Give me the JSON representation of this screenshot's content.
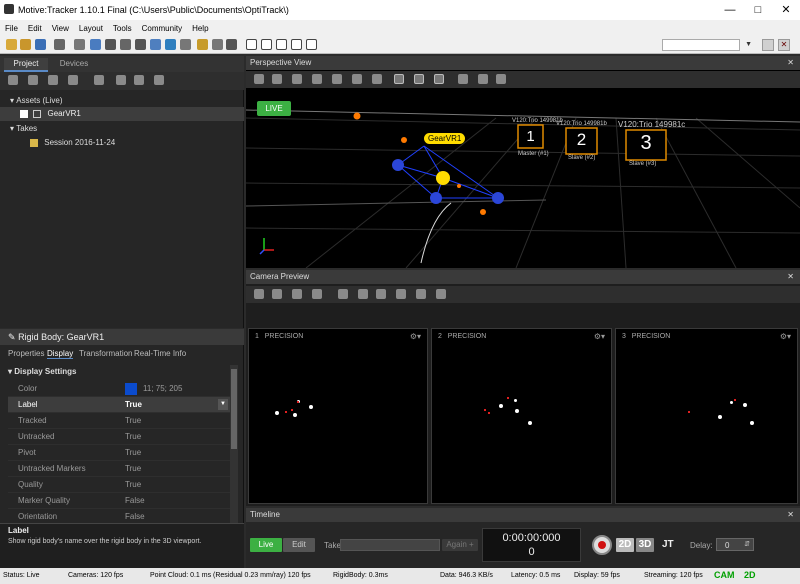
{
  "window": {
    "title": "Motive:Tracker 1.10.1 Final (C:\\Users\\Public\\Documents\\OptiTrack\\)"
  },
  "menu": [
    "File",
    "Edit",
    "View",
    "Layout",
    "Tools",
    "Community",
    "Help"
  ],
  "project_panel": {
    "tabs": [
      "Project",
      "Devices"
    ],
    "tree": {
      "assets_label": "Assets (Live)",
      "asset": "GearVR1",
      "takes_label": "Takes",
      "session": "Session 2016-11-24"
    }
  },
  "properties": {
    "title": "Rigid Body: GearVR1",
    "tabs": [
      "Properties",
      "Display",
      "Transformation",
      "Real-Time Info"
    ],
    "section": "Display Settings",
    "rows": [
      {
        "name": "Color",
        "value": "11; 75; 205"
      },
      {
        "name": "Label",
        "value": "True"
      },
      {
        "name": "Tracked",
        "value": "True"
      },
      {
        "name": "Untracked",
        "value": "True"
      },
      {
        "name": "Pivot",
        "value": "True"
      },
      {
        "name": "Untracked Markers",
        "value": "True"
      },
      {
        "name": "Quality",
        "value": "True"
      },
      {
        "name": "Marker Quality",
        "value": "False"
      },
      {
        "name": "Orientation",
        "value": "False"
      }
    ],
    "color_hex": "#0b4bcd",
    "help_title": "Label",
    "help_text": "Show rigid body's name over the rigid body in the 3D viewport."
  },
  "perspective": {
    "title": "Perspective View",
    "live": "LIVE",
    "rigid_label": "GearVR1",
    "cameras": [
      {
        "num": "1",
        "label": "Master (#1)",
        "tag": "V120:Trio 149981b"
      },
      {
        "num": "2",
        "label": "Slave (#2)",
        "tag": "V120:Trio 149981b"
      },
      {
        "num": "3",
        "label": "Slave (#3)",
        "tag": "V120:Trio 149981c"
      }
    ]
  },
  "camera_preview": {
    "title": "Camera Preview",
    "views": [
      {
        "num": "1",
        "mode": "PRECISION"
      },
      {
        "num": "2",
        "mode": "PRECISION"
      },
      {
        "num": "3",
        "mode": "PRECISION"
      }
    ]
  },
  "timeline": {
    "title": "Timeline",
    "live": "Live",
    "edit": "Edit",
    "take": "Take",
    "again": "Again +",
    "timecode": "0:00:00:000",
    "frame": "0",
    "b2d": "2D",
    "b3d": "3D",
    "jt": "JT",
    "delay_label": "Delay:",
    "delay_value": "0"
  },
  "status": {
    "status": "Status: Live",
    "cameras": "Cameras: 120 fps",
    "pointcloud": "Point Cloud: 0.1 ms (Residual 0.23 mm/ray) 120 fps",
    "rigidbody": "RigidBody: 0.3ms",
    "data": "Data: 946.3 KB/s",
    "latency": "Latency: 0.5 ms",
    "display": "Display: 59 fps",
    "streaming": "Streaming: 120 fps",
    "cam": "CAM",
    "twod": "2D"
  },
  "colors": {
    "accent_green": "#3cb043",
    "status_green": "#00a000"
  }
}
